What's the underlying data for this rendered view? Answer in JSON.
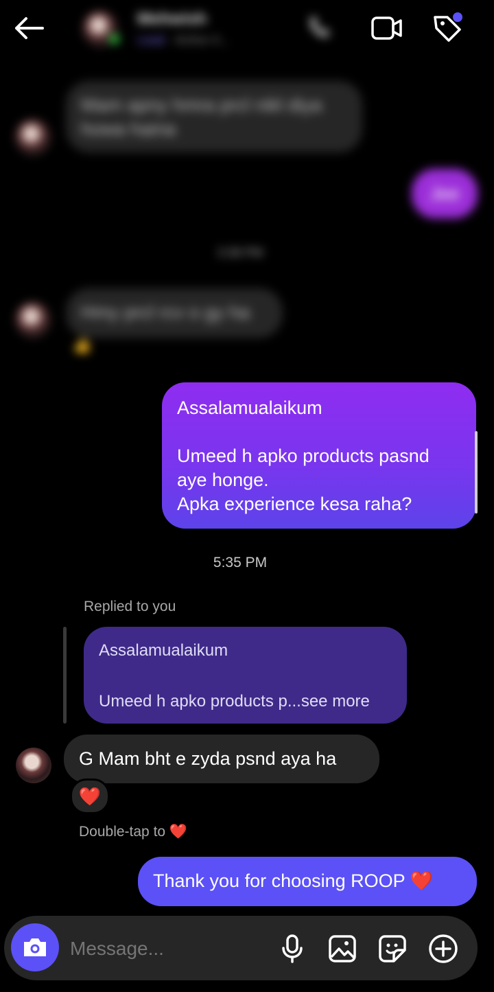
{
  "header": {
    "back_icon": "back-arrow-icon",
    "contact_name": "Mehwish",
    "status": "Active 4...",
    "tag": "Lead",
    "call_icon": "phone-icon",
    "video_icon": "video-camera-icon",
    "tag_icon": "tag-icon"
  },
  "blurred": {
    "msg1": "Mam apny hmra prcl nikl diya howa haina",
    "reply1": "Jee",
    "time": "3:38 PM",
    "msg2": "Hmy prcl rcv o gy ha",
    "reaction": "👍"
  },
  "messages": {
    "outgoing1": "Assalamualaikum\n\nUmeed h apko products pasnd aye honge.\nApka experience kesa raha?",
    "timestamp": "5:35 PM",
    "replied_label": "Replied to you",
    "quote_line1": "Assalamualaikum",
    "quote_line2": "Umeed h apko products p...see more",
    "incoming1": "G Mam bht e zyda psnd aya ha",
    "reaction_heart": "❤️",
    "double_tap_label": "Double-tap to ❤️",
    "outgoing2": "Thank you for choosing ROOP ❤️"
  },
  "composer": {
    "placeholder": "Message...",
    "icons": [
      "camera-icon",
      "microphone-icon",
      "gallery-icon",
      "sticker-icon",
      "plus-icon"
    ]
  },
  "colors": {
    "accent": "#5b51f7",
    "bubble_out_top": "#8f2df0",
    "bubble_out_bottom": "#5d43ea",
    "bubble_in": "#262626",
    "quote_bg": "#3f2a8a"
  }
}
